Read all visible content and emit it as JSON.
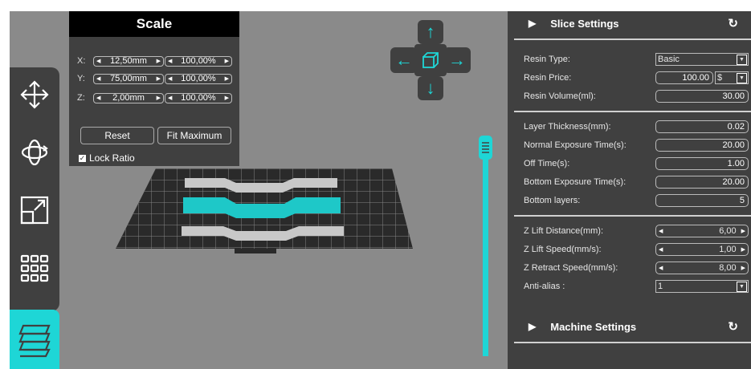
{
  "scale_panel": {
    "title": "Scale",
    "rows": [
      {
        "axis": "X:",
        "size": "12,50mm",
        "percent": "100,00%"
      },
      {
        "axis": "Y:",
        "size": "75,00mm",
        "percent": "100,00%"
      },
      {
        "axis": "Z:",
        "size": "2,00mm",
        "percent": "100,00%"
      }
    ],
    "reset_label": "Reset",
    "fit_label": "Fit Maximum",
    "lock_label": "Lock Ratio",
    "lock_checked": true
  },
  "toolbar": {
    "tools": [
      "move-icon",
      "rotate-icon",
      "scale-icon",
      "arrange-icon",
      "layers-icon"
    ],
    "active": "layers-icon",
    "accent": "#1ed6d6"
  },
  "nav_cross": {
    "up": "↑",
    "down": "↓",
    "left": "←",
    "right": "→"
  },
  "slice_settings": {
    "title": "Slice Settings",
    "resin_type": {
      "label": "Resin Type:",
      "value": "Basic"
    },
    "resin_price": {
      "label": "Resin Price:",
      "value": "100.00",
      "currency": "$"
    },
    "resin_volume": {
      "label": "Resin Volume(ml):",
      "value": "30.00"
    },
    "layer_thickness": {
      "label": "Layer Thickness(mm):",
      "value": "0.02"
    },
    "normal_exposure": {
      "label": "Normal Exposure Time(s):",
      "value": "20.00"
    },
    "off_time": {
      "label": "Off Time(s):",
      "value": "1.00"
    },
    "bottom_exposure": {
      "label": "Bottom Exposure Time(s):",
      "value": "20.00"
    },
    "bottom_layers": {
      "label": "Bottom layers:",
      "value": "5"
    },
    "z_lift_distance": {
      "label": "Z Lift Distance(mm):",
      "value": "6,00"
    },
    "z_lift_speed": {
      "label": "Z Lift Speed(mm/s):",
      "value": "1,00"
    },
    "z_retract_speed": {
      "label": "Z Retract Speed(mm/s):",
      "value": "8,00"
    },
    "anti_alias": {
      "label": "Anti-alias :",
      "value": "1"
    }
  },
  "machine_settings": {
    "title": "Machine Settings"
  }
}
